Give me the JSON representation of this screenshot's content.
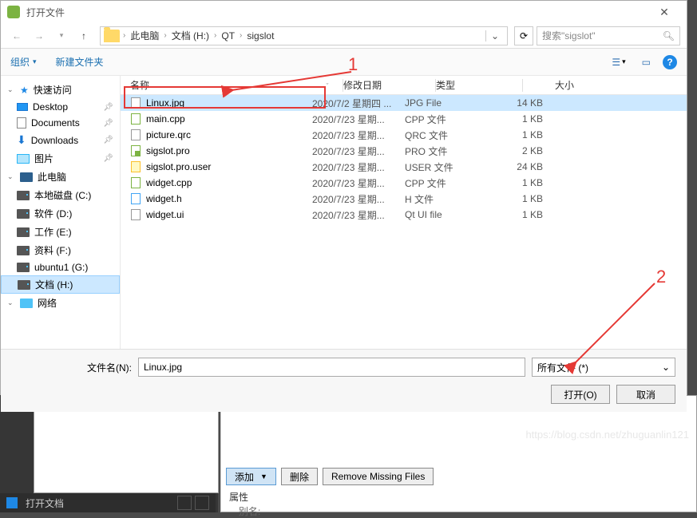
{
  "dialog": {
    "title": "打开文件",
    "close_glyph": "✕"
  },
  "nav": {
    "back_glyph": "←",
    "forward_glyph": "→",
    "recent_glyph": "▾",
    "up_glyph": "↑",
    "refresh_glyph": "⟳",
    "breadcrumb": [
      "此电脑",
      "文档 (H:)",
      "QT",
      "sigslot"
    ],
    "search_placeholder": "搜索\"sigslot\"",
    "search_glyph": "🔍"
  },
  "toolbar": {
    "organize": "组织",
    "organize_caret": "▾",
    "new_folder": "新建文件夹",
    "view_glyph": "☰",
    "view_caret": "▾",
    "preview_glyph": "▭",
    "help_glyph": "?"
  },
  "sidebar": {
    "items": [
      {
        "label": "快速访问",
        "icon": "star",
        "collapsible": true
      },
      {
        "label": "Desktop",
        "icon": "desktop",
        "pinned": true
      },
      {
        "label": "Documents",
        "icon": "document",
        "pinned": true
      },
      {
        "label": "Downloads",
        "icon": "download",
        "pinned": true
      },
      {
        "label": "图片",
        "icon": "pictures",
        "pinned": true
      },
      {
        "label": "此电脑",
        "icon": "pc",
        "collapsible": true
      },
      {
        "label": "本地磁盘 (C:)",
        "icon": "drive"
      },
      {
        "label": "软件 (D:)",
        "icon": "drive"
      },
      {
        "label": "工作 (E:)",
        "icon": "drive"
      },
      {
        "label": "资料 (F:)",
        "icon": "drive"
      },
      {
        "label": "ubuntu1 (G:)",
        "icon": "drive"
      },
      {
        "label": "文档 (H:)",
        "icon": "drive",
        "selected": true
      },
      {
        "label": "网络",
        "icon": "network",
        "collapsible": true
      }
    ]
  },
  "columns": {
    "name": "名称",
    "date": "修改日期",
    "type": "类型",
    "size": "大小",
    "sort_glyph": "ˇ"
  },
  "files": [
    {
      "name": "Linux.jpg",
      "date": "2020/7/2 星期四 ...",
      "type": "JPG File",
      "size": "14 KB",
      "icon": "blank",
      "selected": true
    },
    {
      "name": "main.cpp",
      "date": "2020/7/23 星期...",
      "type": "CPP 文件",
      "size": "1 KB",
      "icon": "cpp"
    },
    {
      "name": "picture.qrc",
      "date": "2020/7/23 星期...",
      "type": "QRC 文件",
      "size": "1 KB",
      "icon": "qrc"
    },
    {
      "name": "sigslot.pro",
      "date": "2020/7/23 星期...",
      "type": "PRO 文件",
      "size": "2 KB",
      "icon": "pro"
    },
    {
      "name": "sigslot.pro.user",
      "date": "2020/7/23 星期...",
      "type": "USER 文件",
      "size": "24 KB",
      "icon": "user"
    },
    {
      "name": "widget.cpp",
      "date": "2020/7/23 星期...",
      "type": "CPP 文件",
      "size": "1 KB",
      "icon": "cpp"
    },
    {
      "name": "widget.h",
      "date": "2020/7/23 星期...",
      "type": "H 文件",
      "size": "1 KB",
      "icon": "h"
    },
    {
      "name": "widget.ui",
      "date": "2020/7/23 星期...",
      "type": "Qt UI file",
      "size": "1 KB",
      "icon": "ui"
    }
  ],
  "footer": {
    "filename_label": "文件名(N):",
    "filename_value": "Linux.jpg",
    "filter_label": "所有文件 (*)",
    "filter_caret": "⌄",
    "open_button": "打开(O)",
    "cancel_button": "取消"
  },
  "annotations": {
    "one": "1",
    "two": "2"
  },
  "background": {
    "add_button": "添加",
    "add_caret": "▼",
    "delete_button": "删除",
    "remove_button": "Remove Missing Files",
    "properties_label": "属性",
    "alias_label": "别名:",
    "status_text": "打开文档"
  },
  "watermark": "https://blog.csdn.net/zhuguanlin121"
}
